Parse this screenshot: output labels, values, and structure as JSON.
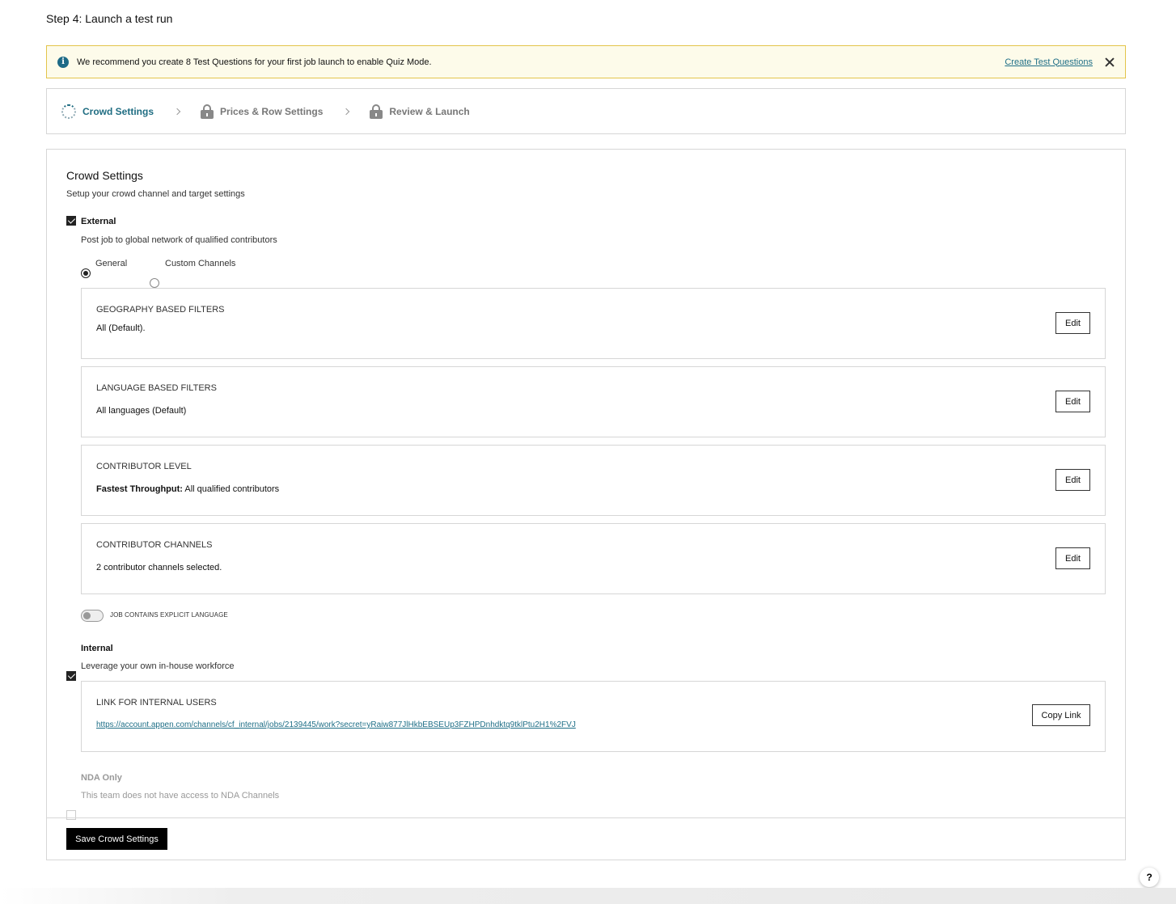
{
  "page": {
    "title": "Step 4: Launch a test run"
  },
  "banner": {
    "icon": "info-icon",
    "text": "We recommend you create 8 Test Questions for your first job launch to enable Quiz Mode.",
    "link_label": "Create Test Questions",
    "close_icon": "close-icon",
    "accent_color": "#e3c44a"
  },
  "stepper": {
    "steps": [
      {
        "label": "Crowd Settings",
        "state": "active",
        "icon": "progress-spinner-icon"
      },
      {
        "label": "Prices & Row Settings",
        "state": "locked",
        "icon": "lock-icon"
      },
      {
        "label": "Review & Launch",
        "state": "locked",
        "icon": "lock-icon"
      }
    ],
    "active_color": "#1f6d82"
  },
  "crowd": {
    "title": "Crowd Settings",
    "subtitle": "Setup your crowd channel and target settings",
    "external": {
      "label": "External",
      "checked": true,
      "description": "Post job to global network of qualified contributors",
      "radio_options": [
        {
          "label": "General",
          "selected": true
        },
        {
          "label": "Custom Channels",
          "selected": false
        }
      ]
    },
    "filters": [
      {
        "title": "GEOGRAPHY BASED FILTERS",
        "value": "All (Default).",
        "button": "Edit"
      },
      {
        "title": "LANGUAGE BASED FILTERS",
        "value": "All languages (Default)",
        "button": "Edit"
      },
      {
        "title": "CONTRIBUTOR LEVEL",
        "value_bold": "Fastest Throughput:",
        "value": " All qualified contributors",
        "button": "Edit"
      },
      {
        "title": "CONTRIBUTOR CHANNELS",
        "value": "2 contributor channels selected.",
        "button": "Edit"
      }
    ],
    "explicit_toggle": {
      "label": "JOB CONTAINS EXPLICIT LANGUAGE",
      "on": false
    },
    "internal": {
      "label": "Internal",
      "checked": true,
      "description": "Leverage your own in-house workforce",
      "link_card": {
        "title": "LINK FOR INTERNAL USERS",
        "url": "https://account.appen.com/channels/cf_internal/jobs/2139445/work?secret=yRaiw877JlHkbEBSEUp3FZHPDnhdktq9tklPtu2H1%2FVJ",
        "button": "Copy Link"
      }
    },
    "nda": {
      "label": "NDA Only",
      "checked": false,
      "disabled": true,
      "description": "This team does not have access to NDA Channels"
    },
    "save_button": "Save Crowd Settings"
  },
  "help": {
    "label": "?"
  }
}
